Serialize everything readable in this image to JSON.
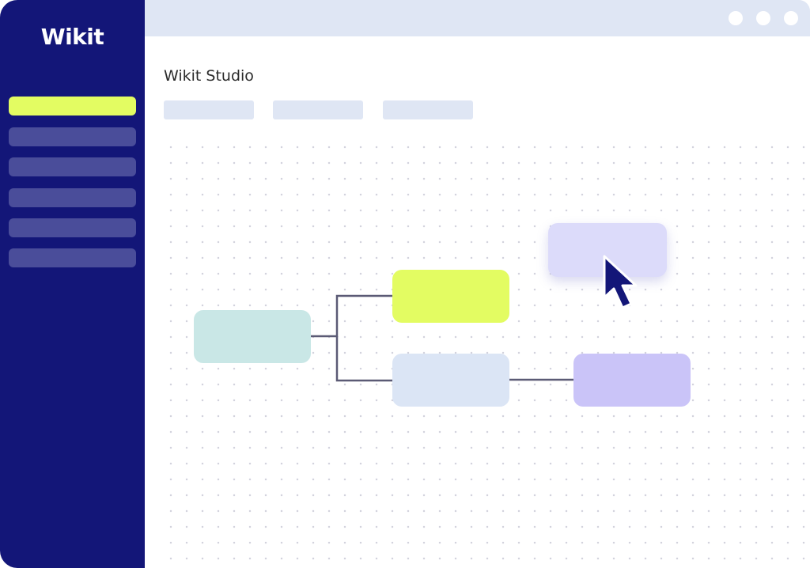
{
  "sidebar": {
    "logo": "Wikit",
    "items": [
      {
        "state": "active"
      },
      {
        "state": "inactive"
      },
      {
        "state": "inactive"
      },
      {
        "state": "inactive"
      },
      {
        "state": "inactive"
      },
      {
        "state": "inactive"
      }
    ]
  },
  "header": {
    "title": "Wikit Studio",
    "tabs": [
      "",
      "",
      ""
    ]
  },
  "flow": {
    "nodes": [
      {
        "id": "root",
        "color": "#c9e7e6"
      },
      {
        "id": "branch-a",
        "color": "#e3fc62"
      },
      {
        "id": "branch-b",
        "color": "#dbe5f5"
      },
      {
        "id": "leaf",
        "color": "#cac4f8"
      },
      {
        "id": "dragged",
        "color": "#dcdbfa"
      }
    ],
    "connector_color": "#5b5a75",
    "cursor_icon": "arrow-pointer-icon"
  },
  "colors": {
    "sidebar_bg": "#131678",
    "accent": "#e3fc62",
    "nav_inactive": "#4a4d9a",
    "topbar": "#dfe6f4"
  }
}
